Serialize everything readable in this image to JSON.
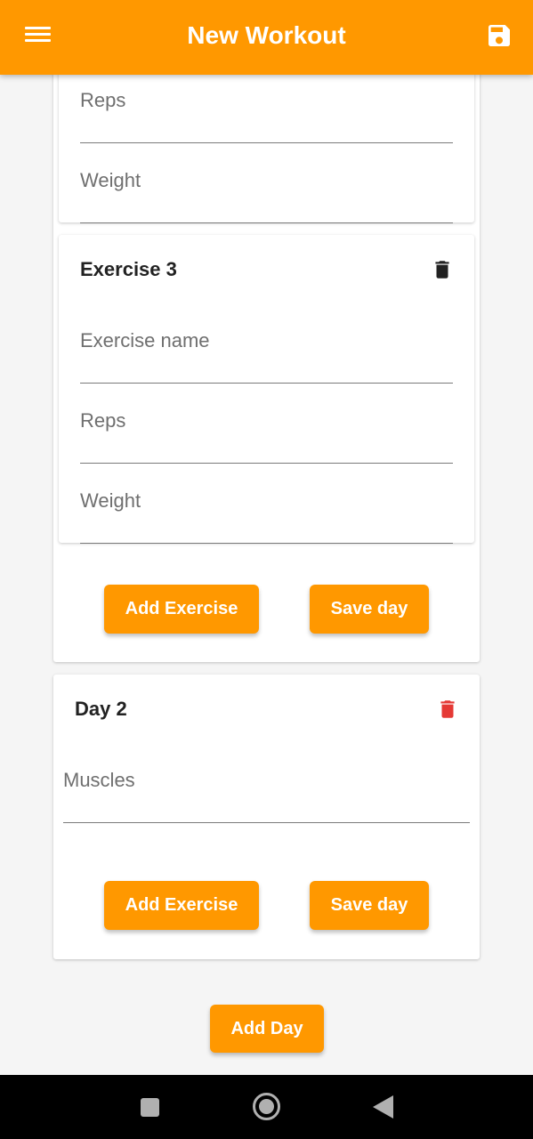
{
  "appbar": {
    "title": "New Workout",
    "menu_icon": "menu-icon",
    "save_icon": "save-icon"
  },
  "day1": {
    "exercise2": {
      "reps_placeholder": "Reps",
      "weight_placeholder": "Weight"
    },
    "exercise3": {
      "title": "Exercise 3",
      "delete_icon": "trash-icon",
      "name_placeholder": "Exercise name",
      "reps_placeholder": "Reps",
      "weight_placeholder": "Weight"
    },
    "add_exercise_label": "Add Exercise",
    "save_day_label": "Save day"
  },
  "day2": {
    "title": "Day 2",
    "delete_icon": "trash-icon",
    "delete_icon_color": "#e53935",
    "muscles_placeholder": "Muscles",
    "add_exercise_label": "Add Exercise",
    "save_day_label": "Save day"
  },
  "add_day_label": "Add Day",
  "colors": {
    "accent": "#ff9800",
    "background": "#f5f5f5",
    "delete_day": "#e53935"
  },
  "system_nav": {
    "recents_icon": "square-icon",
    "home_icon": "circle-home-icon",
    "back_icon": "back-triangle-icon"
  }
}
